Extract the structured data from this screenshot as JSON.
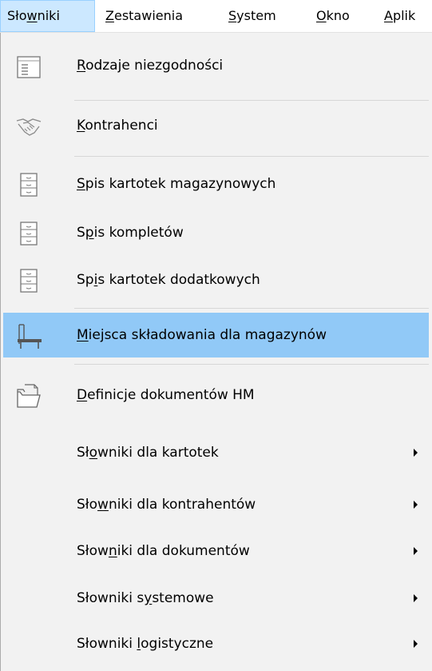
{
  "menubar": {
    "items": [
      {
        "pre": "Sło",
        "key": "w",
        "post": "niki"
      },
      {
        "pre": "",
        "key": "Z",
        "post": "estawienia"
      },
      {
        "pre": "",
        "key": "S",
        "post": "ystem"
      },
      {
        "pre": "",
        "key": "O",
        "post": "kno"
      },
      {
        "pre": "",
        "key": "A",
        "post": "plik"
      }
    ]
  },
  "menu": {
    "items": [
      {
        "pre": "",
        "key": "R",
        "post": "odzaje niezgodności",
        "icon": "list-document-icon"
      },
      {
        "pre": "",
        "key": "K",
        "post": "ontrahenci",
        "icon": "handshake-icon"
      },
      {
        "pre": "",
        "key": "S",
        "post": "pis kartotek magazynowych",
        "icon": "file-cabinet-icon"
      },
      {
        "pre": "S",
        "key": "p",
        "post": "is kompletów",
        "icon": "file-cabinet-icon"
      },
      {
        "pre": "Sp",
        "key": "i",
        "post": "s kartotek dodatkowych",
        "icon": "file-cabinet-icon"
      },
      {
        "pre": "",
        "key": "M",
        "post": "iejsca składowania dla magazynów",
        "icon": "storage-shelf-icon"
      },
      {
        "pre": "",
        "key": "D",
        "post": "efinicje dokumentów HM",
        "icon": "open-folder-icon"
      },
      {
        "pre": "Sł",
        "key": "o",
        "post": "wniki dla kartotek"
      },
      {
        "pre": "Sło",
        "key": "w",
        "post": "niki dla kontrahentów"
      },
      {
        "pre": "Słow",
        "key": "n",
        "post": "iki dla dokumentów"
      },
      {
        "pre": "Słowniki s",
        "key": "y",
        "post": "stemowe"
      },
      {
        "pre": "Słowniki ",
        "key": "l",
        "post": "ogistyczne"
      }
    ]
  }
}
